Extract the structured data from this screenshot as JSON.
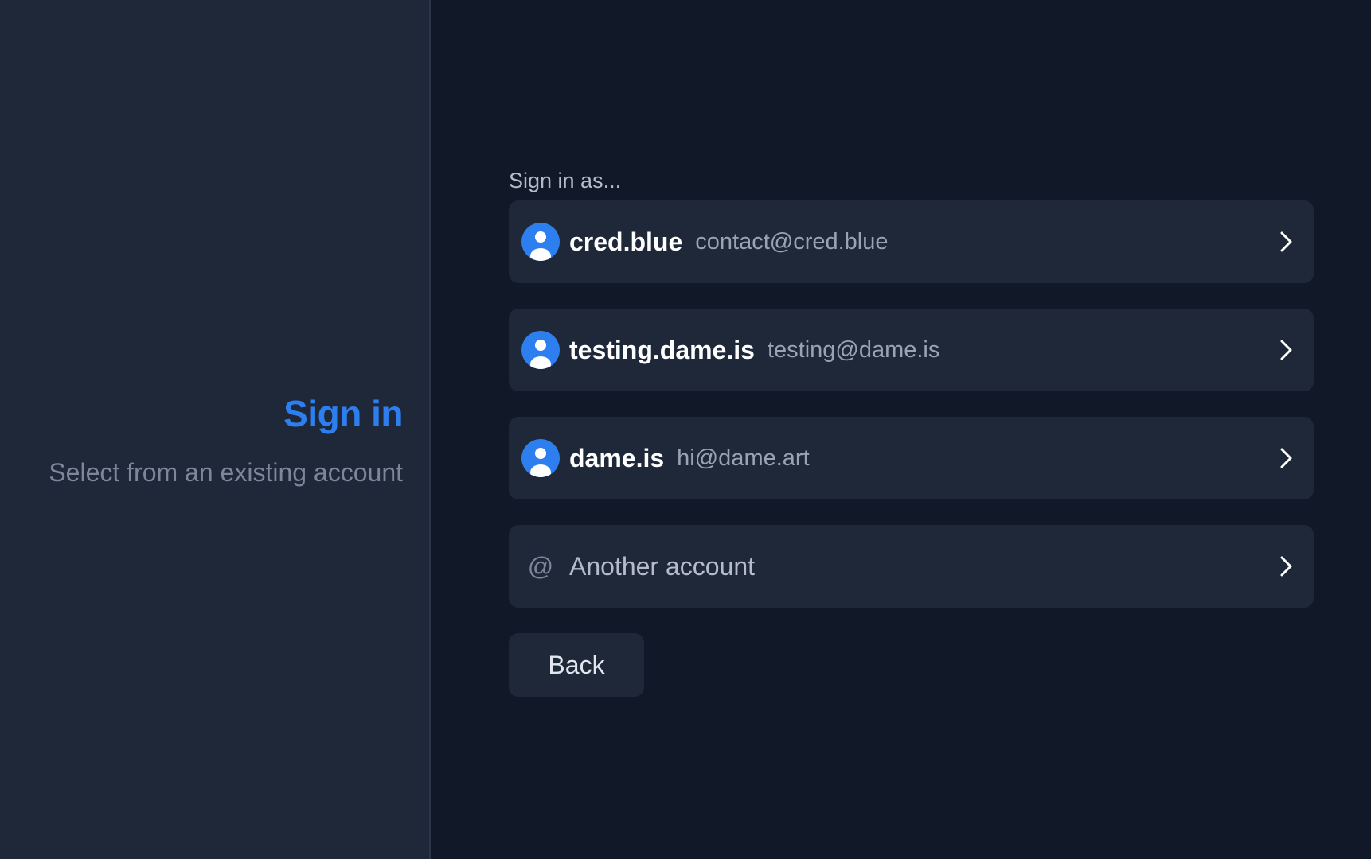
{
  "left": {
    "title": "Sign in",
    "subtitle": "Select from an existing account"
  },
  "main": {
    "section_label": "Sign in as...",
    "accounts": [
      {
        "handle": "cred.blue",
        "email": "contact@cred.blue",
        "icon": "user-avatar-icon"
      },
      {
        "handle": "testing.dame.is",
        "email": "testing@dame.is",
        "icon": "user-avatar-icon"
      },
      {
        "handle": "dame.is",
        "email": "hi@dame.art",
        "icon": "user-avatar-icon"
      }
    ],
    "another_account": {
      "icon": "at-icon",
      "icon_glyph": "@",
      "label": "Another account"
    },
    "back_label": "Back"
  },
  "colors": {
    "background": "#111827",
    "panel": "#1f2839",
    "accent": "#2d7ff0",
    "muted_text": "#7d8799"
  }
}
